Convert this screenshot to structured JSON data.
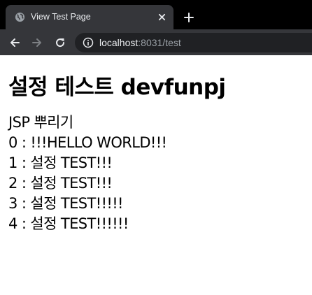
{
  "browser": {
    "tab_title": "View Test Page",
    "url_host": "localhost",
    "url_rest": ":8031/test"
  },
  "page": {
    "title": "설정 테스트 devfunpj",
    "lines": [
      "JSP 뿌리기",
      "0 : !!!HELLO WORLD!!!",
      "1 : 설정 TEST!!!",
      "2 : 설정 TEST!!!",
      "3 : 설정 TEST!!!!!",
      "4 : 설정 TEST!!!!!!"
    ]
  },
  "icons": {
    "favicon": "globe-icon",
    "close": "close-icon",
    "new_tab": "plus-icon",
    "back": "back-arrow-icon",
    "forward": "forward-arrow-icon",
    "reload": "reload-icon",
    "site_info": "info-icon"
  },
  "colors": {
    "tabstrip_bg": "#000000",
    "toolbar_bg": "#35363a",
    "omnibox_bg": "#202124",
    "text_light": "#e8eaed",
    "text_dim": "#9aa0a6",
    "page_bg": "#ffffff",
    "page_text": "#000000"
  }
}
